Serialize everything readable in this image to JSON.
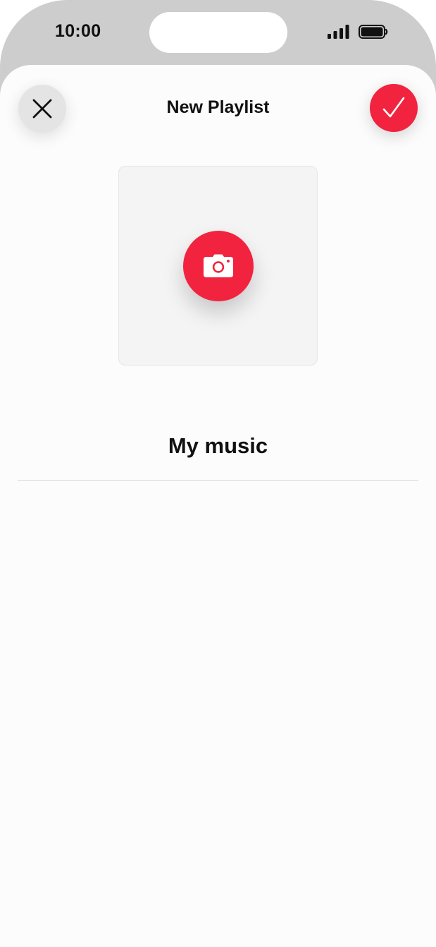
{
  "status_bar": {
    "time": "10:00",
    "signal_icon": "cellular-signal-icon",
    "battery_icon": "battery-icon"
  },
  "header": {
    "title": "New Playlist",
    "close_icon": "close-icon",
    "confirm_icon": "checkmark-icon"
  },
  "artwork": {
    "camera_icon": "camera-icon"
  },
  "playlist": {
    "name": "My music"
  },
  "colors": {
    "accent": "#f2233f",
    "close_bg": "#e4e4e4",
    "frame": "#cdcdcd",
    "sheet_bg": "#fcfcfc",
    "artwork_bg": "#f4f4f4"
  }
}
